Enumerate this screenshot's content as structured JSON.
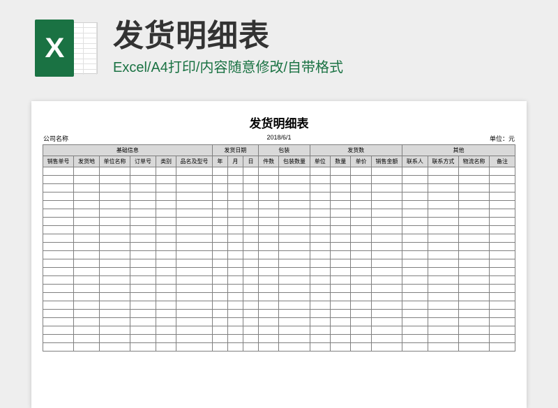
{
  "header": {
    "title": "发货明细表",
    "subtitle": "Excel/A4打印/内容随意修改/自带格式",
    "icon_letter": "X"
  },
  "sheet": {
    "title": "发货明细表",
    "meta": {
      "company_label": "公司名称",
      "date": "2018/6/1",
      "unit_label": "单位：元"
    },
    "group_headers": {
      "basic": "基础信息",
      "ship_date": "发货日期",
      "packing": "包装",
      "ship_qty": "发货数",
      "other": "其他"
    },
    "columns": {
      "sales_no": "销售单号",
      "ship_to": "发货地",
      "unit_name": "单位名称",
      "order_no": "订单号",
      "category": "类别",
      "product": "品名及型号",
      "year": "年",
      "month": "月",
      "day": "日",
      "pieces": "件数",
      "pack_qty": "包装数量",
      "unit": "单位",
      "qty": "数量",
      "price": "单价",
      "amount": "销售金额",
      "contact": "联系人",
      "contact_way": "联系方式",
      "logistics": "物流名称",
      "remark": "备注"
    },
    "empty_rows": 22
  }
}
